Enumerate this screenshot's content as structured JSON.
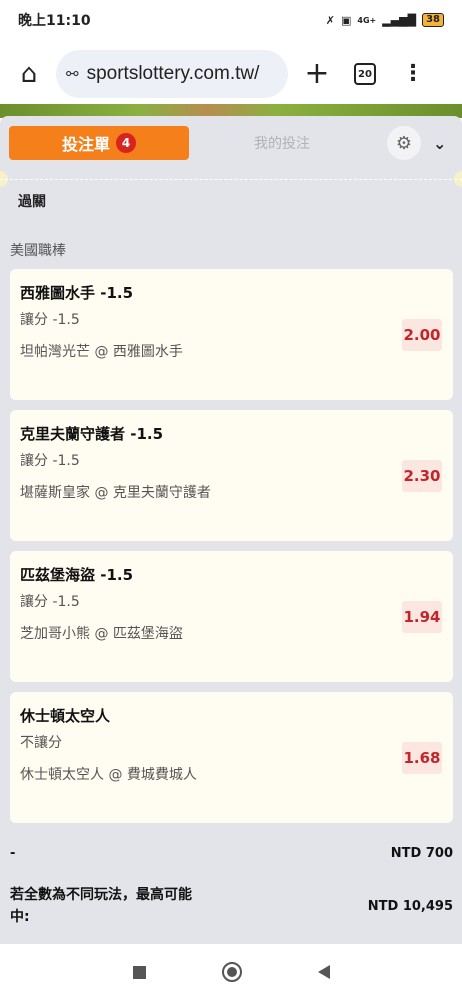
{
  "status_bar": {
    "time": "晚上11:10",
    "network": "4G+",
    "battery": "38"
  },
  "browser": {
    "url": "sportslottery.com.tw/",
    "tab_count": "20"
  },
  "betslip": {
    "tab_active_label": "投注單",
    "tab_active_count": "4",
    "tab_inactive_label": "我的投注",
    "section_label": "過關",
    "league": "美國職棒",
    "bets": [
      {
        "title": "西雅圖水手 -1.5",
        "bet_type": "讓分 -1.5",
        "match": "坦帕灣光芒 @ 西雅圖水手",
        "odds": "2.00"
      },
      {
        "title": "克里夫蘭守護者 -1.5",
        "bet_type": "讓分 -1.5",
        "match": "堪薩斯皇家 @ 克里夫蘭守護者",
        "odds": "2.30"
      },
      {
        "title": "匹茲堡海盜 -1.5",
        "bet_type": "讓分 -1.5",
        "match": "芝加哥小熊 @ 匹茲堡海盜",
        "odds": "1.94"
      },
      {
        "title": "休士頓太空人",
        "bet_type": "不讓分",
        "match": "休士頓太空人 @ 費城費城人",
        "odds": "1.68"
      }
    ],
    "stake_label": "-",
    "stake_value": "NTD 700",
    "max_win_label_line1": "若全數為不同玩法，最高可能",
    "max_win_label_line2": "中:",
    "max_win_value": "NTD 10,495"
  },
  "colors": {
    "accent_orange": "#f47f1b",
    "odds_red": "#c0262c",
    "panel_bg": "#e3e4e9",
    "card_bg": "#fffdf2"
  }
}
